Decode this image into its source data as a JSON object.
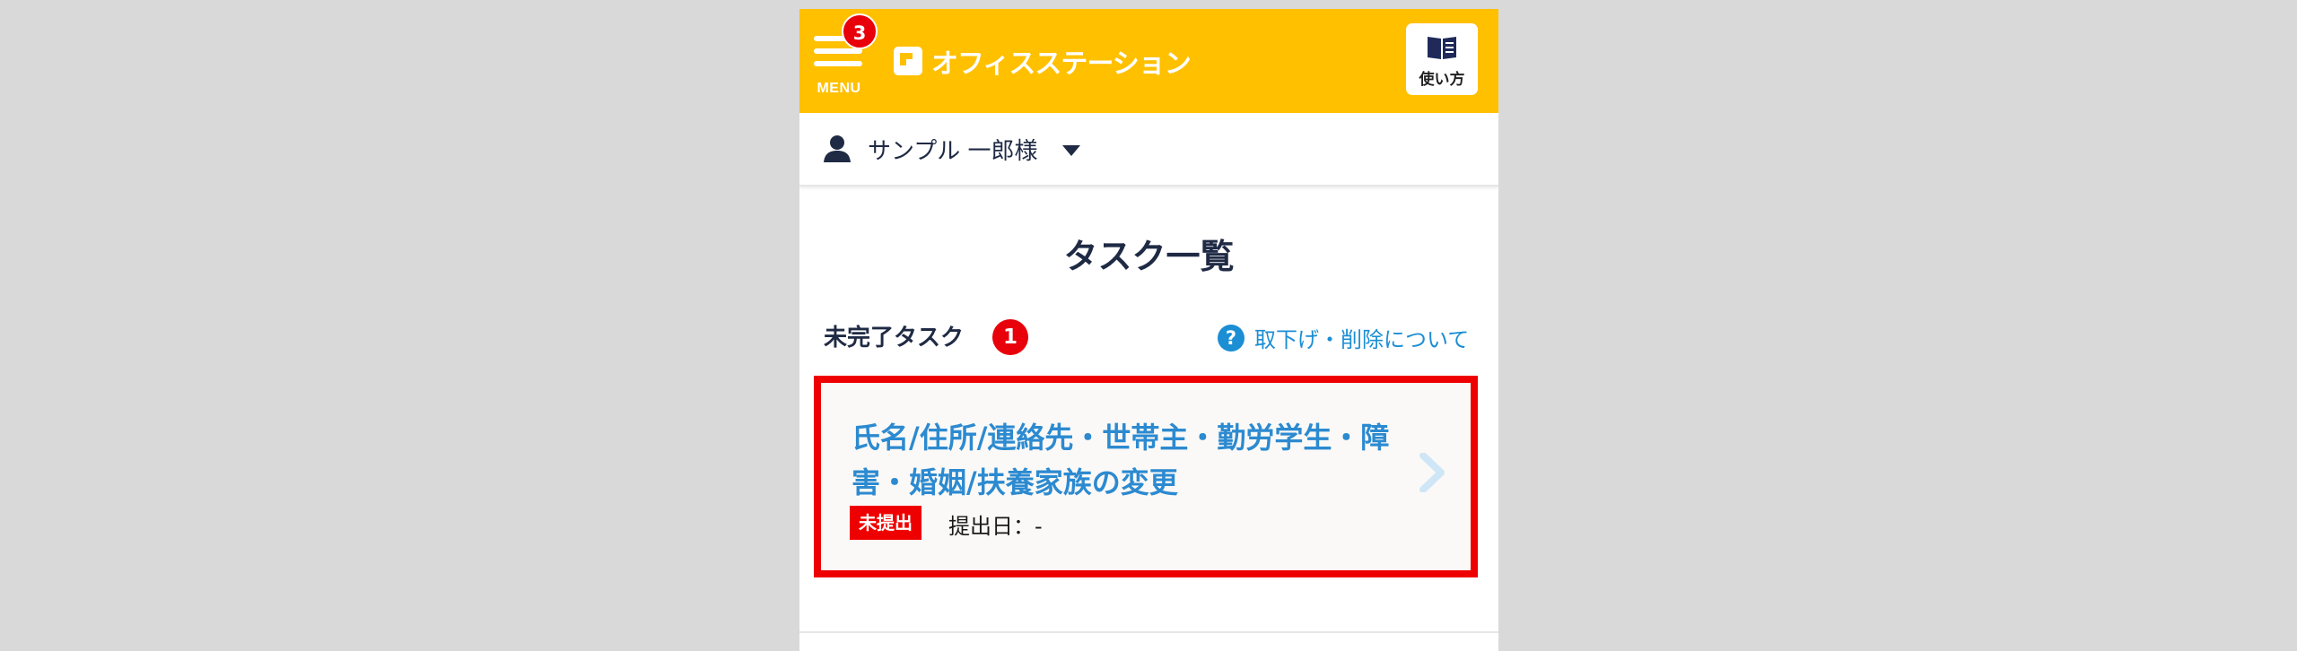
{
  "header": {
    "menu_label": "MENU",
    "menu_badge": "3",
    "logo_text": "オフィスステーション",
    "howto_label": "使い方",
    "bg_color": "#ffc000"
  },
  "user": {
    "name": "サンプル 一郎様"
  },
  "page": {
    "title": "タスク一覧"
  },
  "incomplete": {
    "label": "未完了タスク",
    "count": "1",
    "help_link": "取下げ・削除について"
  },
  "tasks": [
    {
      "title": "氏名/住所/連絡先・世帯主・勤労学生・障害・婚姻/扶養家族の変更",
      "status": "未提出",
      "submitted": "提出日：-"
    }
  ],
  "colors": {
    "accent": "#ffc000",
    "alert": "#ef0000",
    "link": "#1b8ed4",
    "text": "#1f2a44"
  }
}
